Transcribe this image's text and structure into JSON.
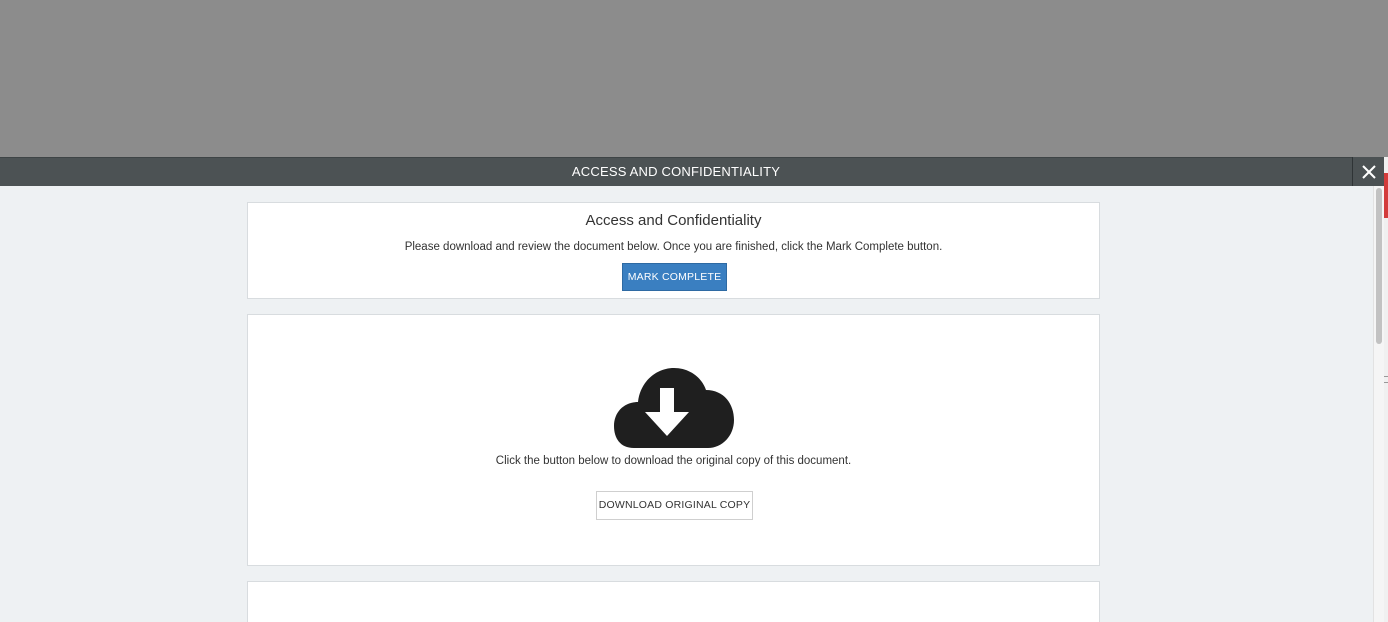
{
  "modal": {
    "header_title": "ACCESS AND CONFIDENTIALITY",
    "close_icon": "close-icon"
  },
  "intro_card": {
    "title": "Access and Confidentiality",
    "description": "Please download and review the document below. Once you are finished, click the Mark Complete button.",
    "mark_complete_label": "MARK COMPLETE"
  },
  "download_card": {
    "icon": "cloud-download-icon",
    "description": "Click the button below to download the original copy of this document.",
    "download_label": "DOWNLOAD ORIGINAL COPY"
  },
  "colors": {
    "overlay": "#8c8c8c",
    "header_bg": "#4c5254",
    "modal_bg": "#eef1f3",
    "primary_button": "#3a7fc1",
    "accent_red": "#d33b3b"
  }
}
